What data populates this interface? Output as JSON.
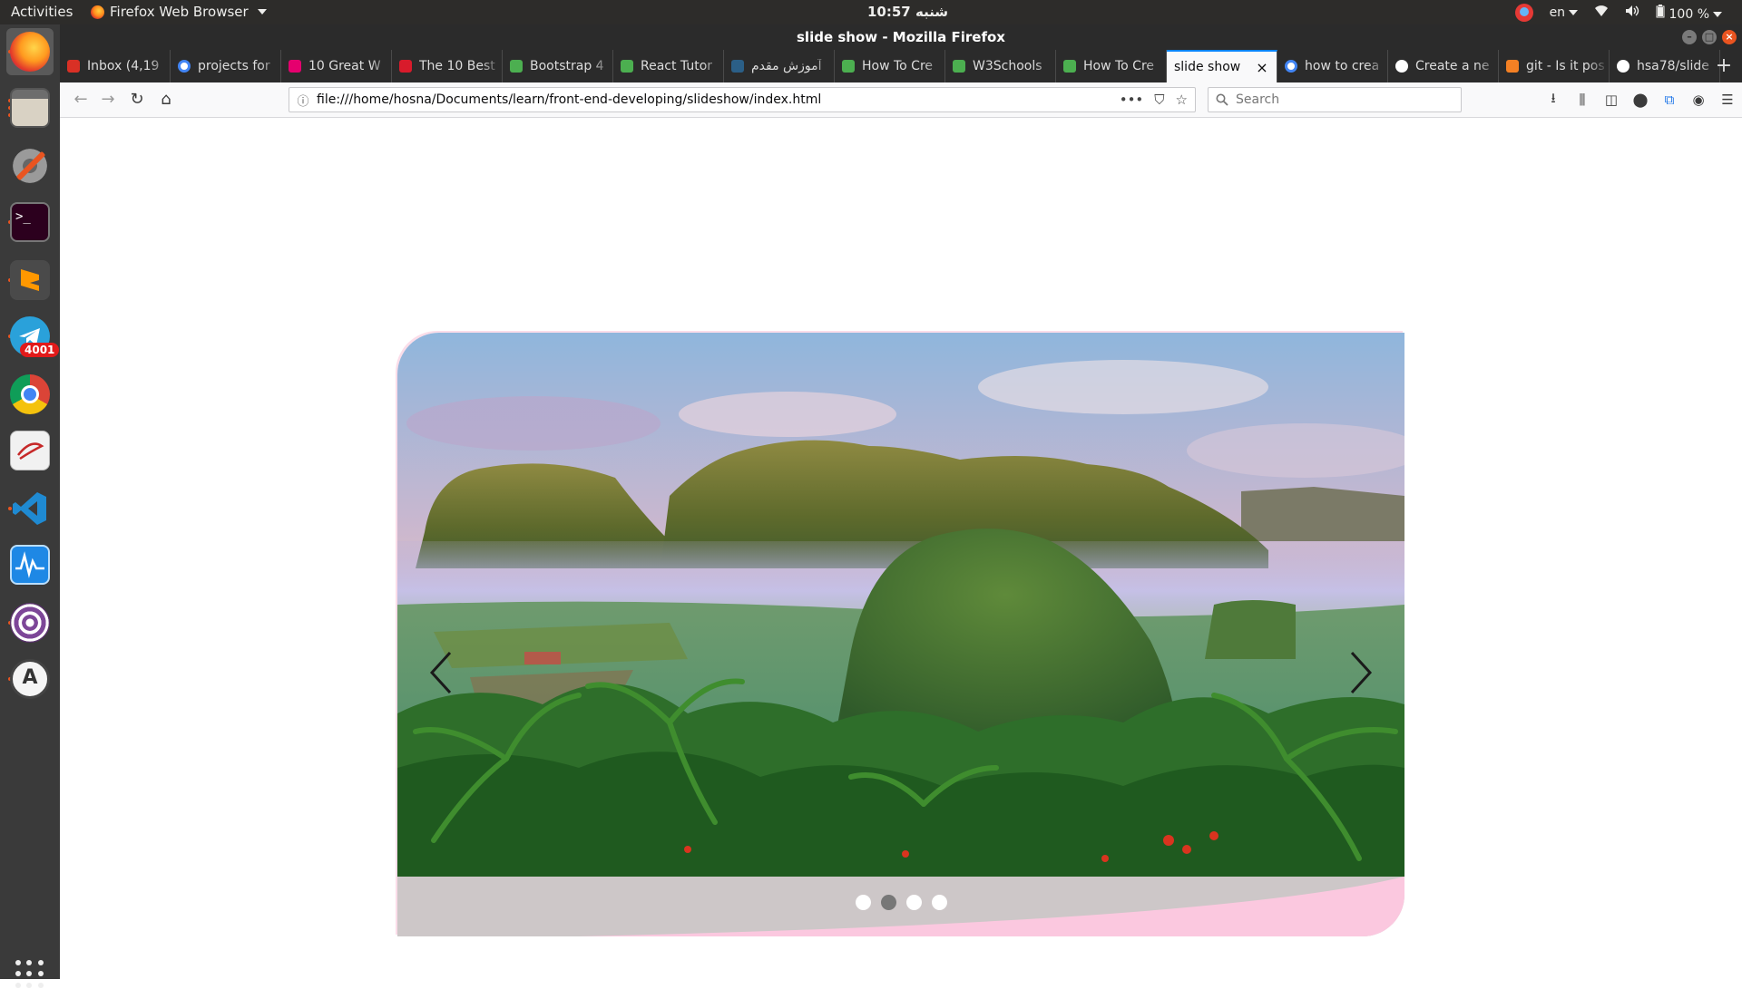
{
  "system": {
    "activities": "Activities",
    "app_menu": "Firefox Web Browser",
    "clock": "10:57 شنبه",
    "keyboard_layout": "en",
    "battery": "100 %"
  },
  "dock": {
    "badge_count": "4001",
    "apps": [
      "firefox",
      "files",
      "settings",
      "terminal",
      "sublime-text",
      "telegram",
      "chrome",
      "evince",
      "vscode",
      "system-monitor",
      "tor",
      "software-updater"
    ]
  },
  "window": {
    "title": "slide show - Mozilla Firefox"
  },
  "tabs": [
    {
      "label": "Inbox (4,19",
      "icon": "gmail-icon",
      "color": "#d93025"
    },
    {
      "label": "projects for",
      "icon": "google-icon",
      "color": "#4285f4"
    },
    {
      "label": "10 Great W",
      "icon": "r-icon",
      "color": "#e5006e"
    },
    {
      "label": "The 10 Best",
      "icon": "book-icon",
      "color": "#d81b2b"
    },
    {
      "label": "Bootstrap 4",
      "icon": "w3-icon",
      "color": "#4caf50"
    },
    {
      "label": "React Tutor",
      "icon": "w3-icon",
      "color": "#4caf50"
    },
    {
      "label": "آموزش مقدم",
      "icon": "site-icon",
      "color": "#2b5f87"
    },
    {
      "label": "How To Cre",
      "icon": "w3-icon",
      "color": "#4caf50"
    },
    {
      "label": "W3Schools",
      "icon": "w3-icon",
      "color": "#4caf50"
    },
    {
      "label": "How To Cre",
      "icon": "w3-icon",
      "color": "#4caf50"
    },
    {
      "label": "slide show",
      "icon": "",
      "color": "",
      "selected": true
    },
    {
      "label": "how to crea",
      "icon": "google-icon",
      "color": "#4285f4"
    },
    {
      "label": "Create a ne",
      "icon": "github-icon",
      "color": "#ffffff"
    },
    {
      "label": "git - Is it pos",
      "icon": "stackoverflow-icon",
      "color": "#f48024"
    },
    {
      "label": "hsa78/slide",
      "icon": "github-icon",
      "color": "#ffffff"
    }
  ],
  "navbar": {
    "url": "file:///home/hosna/Documents/learn/front-end-developing/slideshow/index.html",
    "search_placeholder": "Search"
  },
  "slideshow": {
    "slide_count": 4,
    "active_slide": 2,
    "prev_symbol": "‹",
    "next_symbol": "›",
    "footer_color": "#cdc7c8",
    "accent_color": "#fbc8df"
  }
}
